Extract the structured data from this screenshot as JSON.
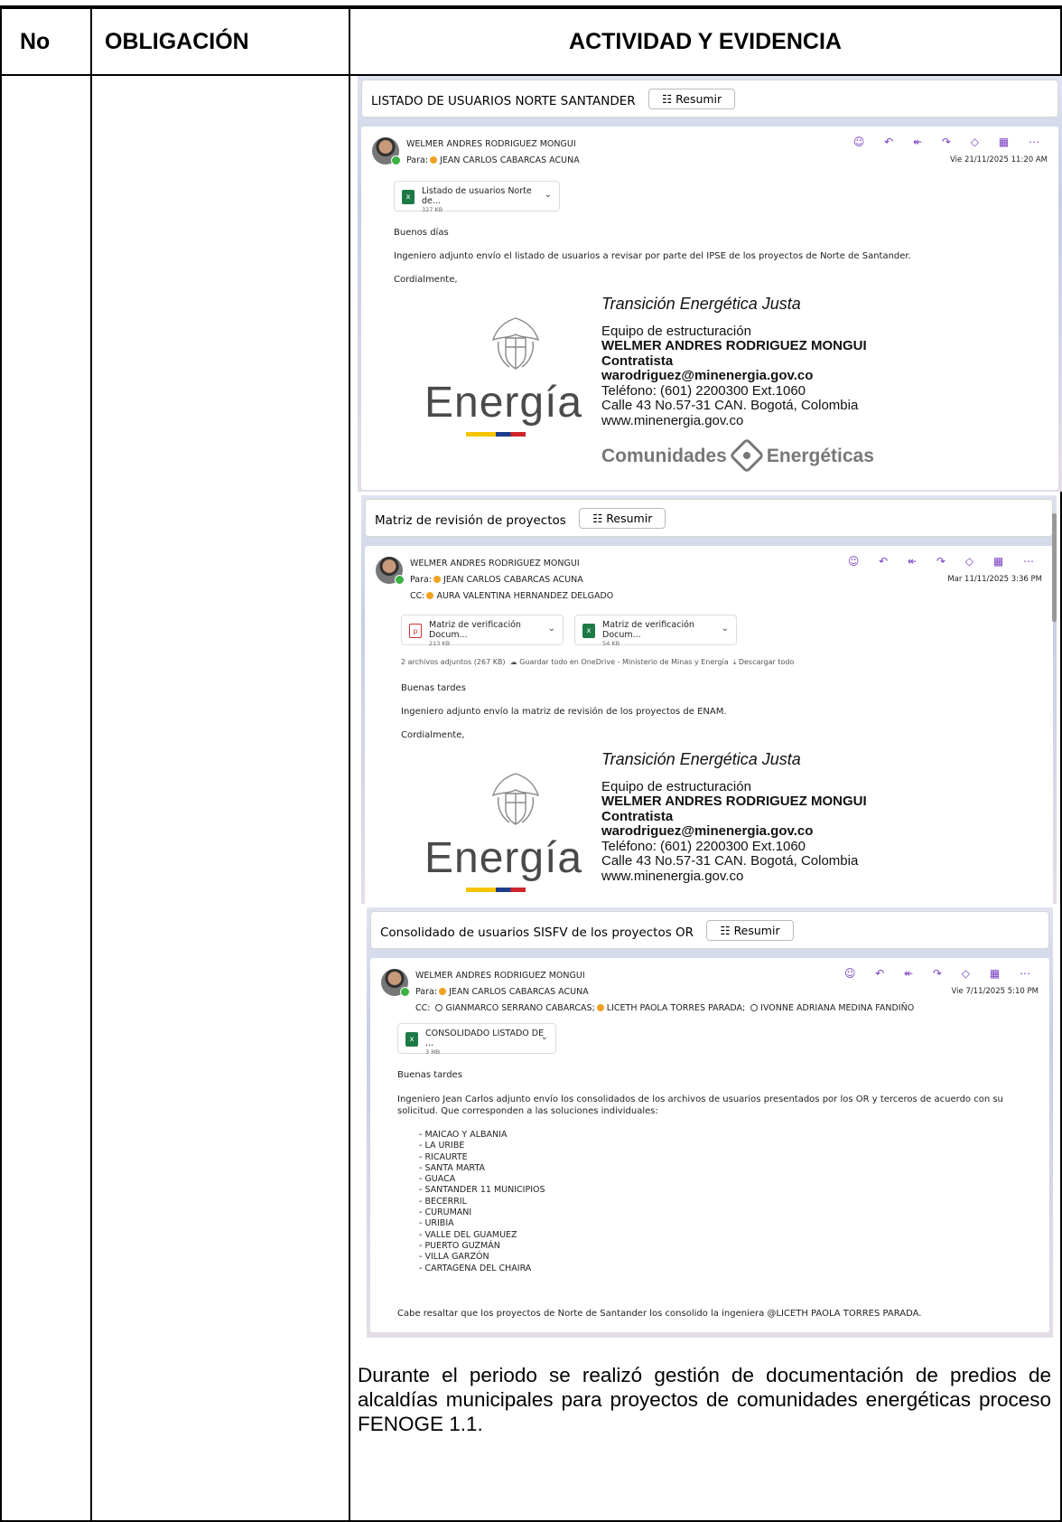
{
  "doc": {
    "top_fragment": "",
    "headers": {
      "no": "No",
      "obligacion": "OBLIGACIÓN",
      "actividad": "ACTIVIDAD Y EVIDENCIA"
    },
    "footer_text": "Durante el periodo se realizó gestión de documentación de predios de alcaldías municipales para proyectos de comunidades energéticas proceso FENOGE 1.1."
  },
  "summarize_label": "Resumir",
  "signature": {
    "tagline": "Transición Energética Justa",
    "team": "Equipo de estructuración",
    "name": "WELMER ANDRES RODRIGUEZ MONGUI",
    "role": "Contratista",
    "email": "warodriguez@minenergia.gov.co",
    "phone": "Teléfono: (601) 2200300 Ext.1060",
    "address": "Calle 43 No.57-31 CAN. Bogotá, Colombia",
    "web": "www.minenergia.gov.co",
    "logo_word": "Energía",
    "program_left": "Comunidades",
    "program_right": "Energéticas"
  },
  "emails": [
    {
      "subject": "LISTADO DE USUARIOS NORTE SANTANDER",
      "from": "WELMER ANDRES RODRIGUEZ MONGUI",
      "to_prefix": "Para:",
      "to": "JEAN CARLOS CABARCAS ACUNA",
      "date": "Vie 21/11/2025 11:20 AM",
      "attachments": [
        {
          "name": "Listado de usuarios Norte de...",
          "size": "327 KB"
        }
      ],
      "greeting": "Buenos días",
      "body": "Ingeniero adjunto envío el listado de usuarios a revisar por parte del IPSE de los proyectos de Norte de Santander.",
      "closing": "Cordialmente,"
    },
    {
      "subject": "Matriz de revisión de proyectos",
      "from": "WELMER ANDRES RODRIGUEZ MONGUI",
      "to_prefix": "Para:",
      "to": "JEAN CARLOS CABARCAS ACUNA",
      "cc_prefix": "CC:",
      "cc": "AURA VALENTINA HERNANDEZ DELGADO",
      "date": "Mar 11/11/2025 3:36 PM",
      "attachments": [
        {
          "name": "Matriz de verificación Docum...",
          "size": "213 KB"
        },
        {
          "name": "Matriz de verificación Docum...",
          "size": "54 KB"
        }
      ],
      "attach_summary": "2 archivos adjuntos (267 KB)",
      "save_onedrive": "Guardar todo en OneDrive - Ministerio de Minas y Energía",
      "download_all": "Descargar todo",
      "greeting": "Buenas tardes",
      "body": "Ingeniero adjunto envío la matriz de revisión de los proyectos de ENAM.",
      "closing": "Cordialmente,"
    },
    {
      "subject": "Consolidado de usuarios SISFV de los proyectos OR",
      "from": "WELMER ANDRES RODRIGUEZ MONGUI",
      "to_prefix": "Para:",
      "to": "JEAN CARLOS CABARCAS ACUNA",
      "cc_prefix": "CC:",
      "cc1": "GIANMARCO SERRANO CABARCAS;",
      "cc2": "LICETH PAOLA TORRES PARADA;",
      "cc3": "IVONNE ADRIANA MEDINA FANDIÑO",
      "date": "Vie 7/11/2025 5:10 PM",
      "attachments": [
        {
          "name": "CONSOLIDADO LISTADO DE ...",
          "size": "3 MB"
        }
      ],
      "greeting": "Buenas tardes",
      "body": "Ingeniero Jean Carlos adjunto envío los consolidados de los archivos de usuarios presentados por los OR y terceros de acuerdo con su solicitud. Que corresponden a las soluciones individuales:",
      "places": [
        "- MAICAO Y ALBANIA",
        "- LA URIBE",
        "- RICAURTE",
        "- SANTA MARTA",
        "- GUACA",
        "- SANTANDER 11 MUNICIPIOS",
        "- BECERRIL",
        "- CURUMANI",
        "- URIBIA",
        "- VALLE DEL GUAMUEZ",
        "- PUERTO GUZMÁN",
        "- VILLA GARZÓN",
        "- CARTAGENA DEL CHAIRA"
      ],
      "note": "Cabe resaltar que los proyectos de Norte de Santander los consolido la ingeniera @LICETH PAOLA TORRES PARADA."
    }
  ]
}
